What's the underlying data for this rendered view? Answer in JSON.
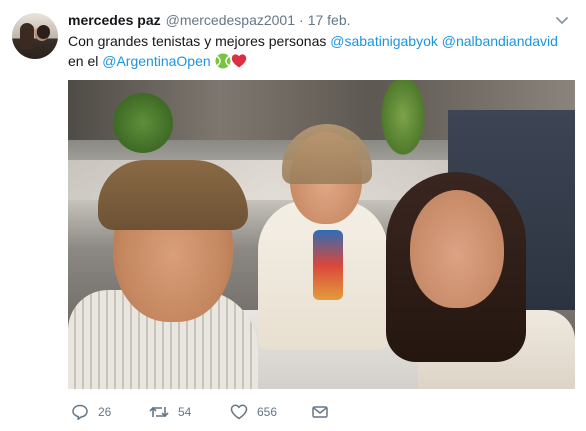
{
  "tweet": {
    "author_name": "mercedes paz",
    "author_handle": "@mercedespaz2001",
    "separator": "·",
    "date": "17 feb.",
    "text_segments": [
      {
        "type": "text",
        "value": "Con grandes tenistas y mejores personas "
      },
      {
        "type": "mention",
        "value": "@sabatinigabyok"
      },
      {
        "type": "text",
        "value": " "
      },
      {
        "type": "mention",
        "value": "@nalbandiandavid"
      },
      {
        "type": "text",
        "value": " en el "
      },
      {
        "type": "mention",
        "value": "@ArgentinaOpen"
      },
      {
        "type": "text",
        "value": " "
      }
    ],
    "emojis": [
      "tennis-ball-emoji",
      "red-heart-emoji"
    ],
    "media_alt": "Selfie of three people seated at a table in a crowded indoor event",
    "actions": {
      "reply": {
        "icon": "reply-icon",
        "count": "26"
      },
      "retweet": {
        "icon": "retweet-icon",
        "count": "54"
      },
      "like": {
        "icon": "heart-icon",
        "count": "656"
      },
      "message": {
        "icon": "envelope-icon"
      }
    }
  },
  "colors": {
    "text": "#14171a",
    "secondary": "#657786",
    "link": "#1b95e0",
    "heart": "#e0245e",
    "tennis_ball": "#7cc242"
  }
}
